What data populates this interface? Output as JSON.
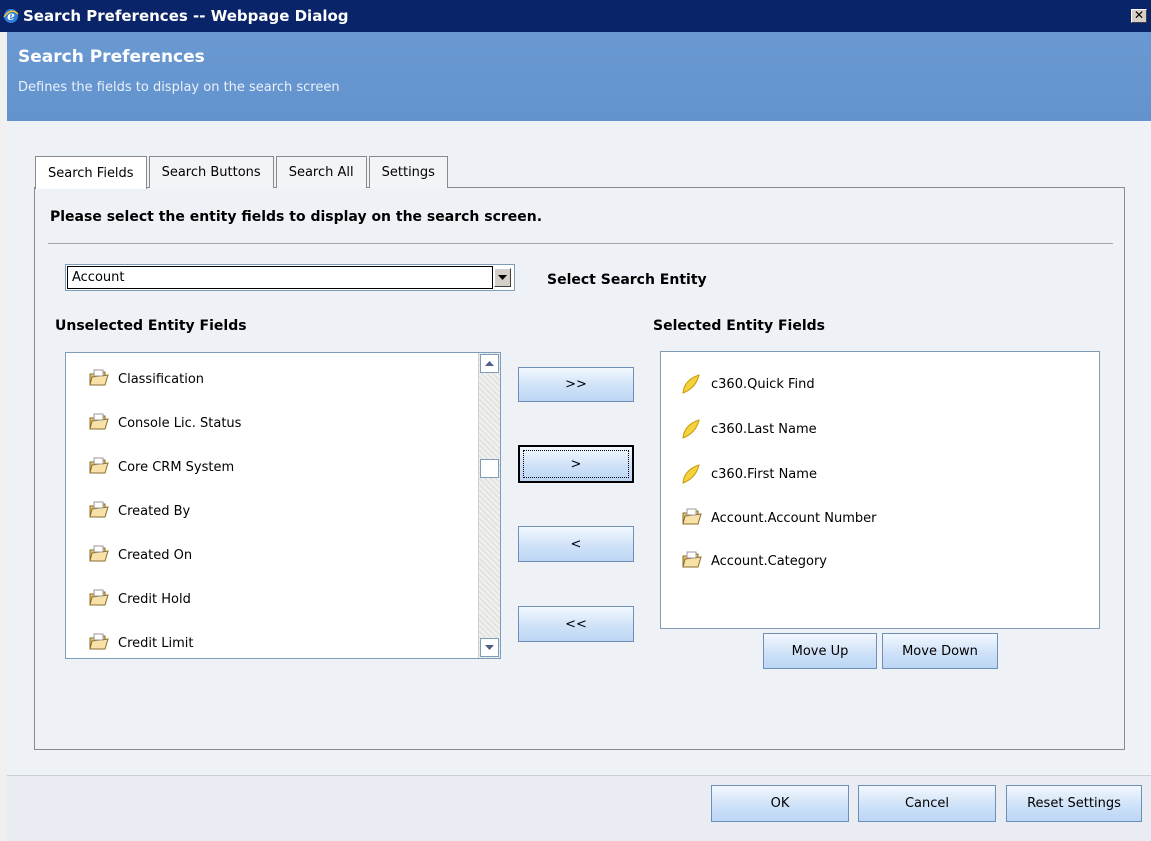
{
  "window": {
    "title": "Search Preferences -- Webpage Dialog",
    "close_glyph": "✕"
  },
  "header": {
    "title": "Search Preferences",
    "subtitle": "Defines the fields to display on the search screen"
  },
  "tabs": [
    {
      "label": "Search Fields",
      "active": true
    },
    {
      "label": "Search Buttons",
      "active": false
    },
    {
      "label": "Search All",
      "active": false
    },
    {
      "label": "Settings",
      "active": false
    }
  ],
  "instruction": "Please select the entity fields to display on the search screen.",
  "entity_select": {
    "value": "Account",
    "label": "Select Search Entity"
  },
  "unselected": {
    "heading": "Unselected Entity Fields",
    "items": [
      "Classification",
      "Console Lic. Status",
      "Core CRM System",
      "Created By",
      "Created On",
      "Credit Hold",
      "Credit Limit"
    ]
  },
  "selected": {
    "heading": "Selected Entity Fields",
    "items": [
      {
        "label": "c360.Quick Find",
        "icon": "leaf-icon"
      },
      {
        "label": "c360.Last Name",
        "icon": "leaf-icon"
      },
      {
        "label": "c360.First Name",
        "icon": "leaf-icon"
      },
      {
        "label": "Account.Account Number",
        "icon": "folder-icon"
      },
      {
        "label": "Account.Category",
        "icon": "folder-icon"
      }
    ]
  },
  "transfer": {
    "add_all": ">>",
    "add": ">",
    "remove": "<",
    "remove_all": "<<"
  },
  "order": {
    "up": "Move Up",
    "down": "Move Down"
  },
  "footer": {
    "ok": "OK",
    "cancel": "Cancel",
    "reset": "Reset Settings"
  },
  "colors": {
    "titlebar": "#0a246a",
    "header": "#6495cf",
    "button": "#cfe2f8"
  }
}
